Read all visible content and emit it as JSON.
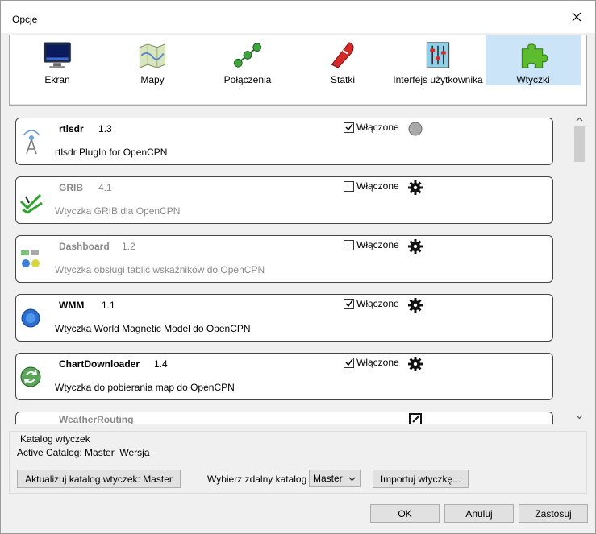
{
  "window": {
    "title": "Opcje"
  },
  "toolbar": {
    "items": [
      {
        "label": "Ekran",
        "icon": "monitor-icon"
      },
      {
        "label": "Mapy",
        "icon": "map-icon"
      },
      {
        "label": "Połączenia",
        "icon": "connections-icon"
      },
      {
        "label": "Statki",
        "icon": "ship-icon"
      },
      {
        "label": "Interfejs użytkownika",
        "icon": "sliders-icon"
      },
      {
        "label": "Wtyczki",
        "icon": "puzzle-icon",
        "selected": true
      }
    ]
  },
  "plugins": [
    {
      "name": "rtlsdr",
      "version": "1.3",
      "description": "rtlsdr PlugIn for OpenCPN",
      "enabled_label": "Włączone",
      "enabled": true,
      "status": "gray-dot-icon"
    },
    {
      "name": "GRIB",
      "version": "4.1",
      "description": "Wtyczka GRIB dla OpenCPN",
      "enabled_label": "Włączone",
      "enabled": false,
      "status": "gear-icon"
    },
    {
      "name": "Dashboard",
      "version": "1.2",
      "description": "Wtyczka obsługi tablic wskaźników do OpenCPN",
      "enabled_label": "Włączone",
      "enabled": false,
      "status": "gear-icon"
    },
    {
      "name": "WMM",
      "version": "1.1",
      "description": "Wtyczka World Magnetic Model do OpenCPN",
      "enabled_label": "Włączone",
      "enabled": true,
      "status": "gear-icon"
    },
    {
      "name": "ChartDownloader",
      "version": "1.4",
      "description": "Wtyczka do pobierania map do OpenCPN",
      "enabled_label": "Włączone",
      "enabled": true,
      "status": "gear-icon"
    },
    {
      "name": "WeatherRouting",
      "version": "",
      "description": "",
      "enabled_label": "",
      "enabled": false,
      "status": ""
    }
  ],
  "catalog": {
    "title": "Katalog wtyczek",
    "active_line": "Active Catalog: Master  Wersja",
    "update_button": "Aktualizuj katalog wtyczek: Master",
    "remote_label": "Wybierz zdalny katalog",
    "remote_selected": "Master",
    "import_button": "Importuj wtyczkę..."
  },
  "footer": {
    "ok": "OK",
    "cancel": "Anuluj",
    "apply": "Zastosuj"
  },
  "colors": {
    "accent": "#0078d7",
    "selected_tab": "#cce4f7"
  }
}
